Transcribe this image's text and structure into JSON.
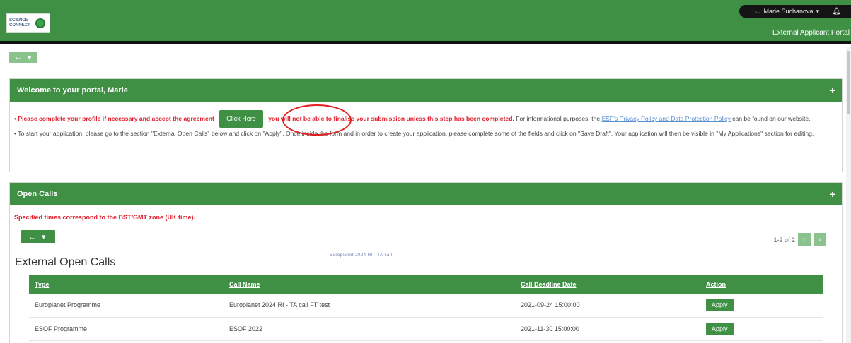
{
  "header": {
    "logo_text": "SCIENCE CONNECT",
    "user_menu": "Marie Suchanova",
    "user_caret": "▾",
    "portal_label": "External Applicant Portal"
  },
  "nav": {
    "back_arrow": "←",
    "caret": "▾"
  },
  "welcome": {
    "title": "Welcome to your portal, Marie",
    "bullet1_red_start": "Please complete your profile if necessary and accept the agreement",
    "click_here": "Click Here",
    "bullet1_red_end": "you will not be able to finalise your submission unless this step has been completed.",
    "bullet1_normal": "For informational purposes, the",
    "policy_link": "ESF's Privacy Policy and Data Protection Policy",
    "bullet1_tail": "can be found on our website.",
    "bullet2": "To start your application, please go to the section \"External Open Calls\" below and click on \"Apply\". Once inside the form and in order to create your application, please complete some of the fields and click on \"Save Draft\". Your application will then be visible in \"My Applications\" section for editing."
  },
  "open_calls": {
    "title": "Open Calls",
    "timezone_note": "Specified times correspond to the BST/GMT zone (UK time).",
    "pager_text": "1-2 of 2",
    "prev_icon": "‹",
    "next_icon": "›",
    "overlay_text": "Europlanet 2024 RI - TA call",
    "section_title": "External Open Calls",
    "columns": [
      "Type",
      "Call Name",
      "Call Deadline Date",
      "Action"
    ],
    "rows": [
      {
        "type": "Europlanet Programme",
        "call_name": "Europlanet 2024 RI - TA call FT test",
        "deadline": "2021-09-24 15:00:00",
        "action": "Apply"
      },
      {
        "type": "ESOF Programme",
        "call_name": "ESOF 2022",
        "deadline": "2021-11-30 15:00:00",
        "action": "Apply"
      }
    ]
  },
  "colors": {
    "brand_green": "#3f8f45",
    "light_green": "#8bc38f",
    "alert_red": "#e11d2b"
  }
}
